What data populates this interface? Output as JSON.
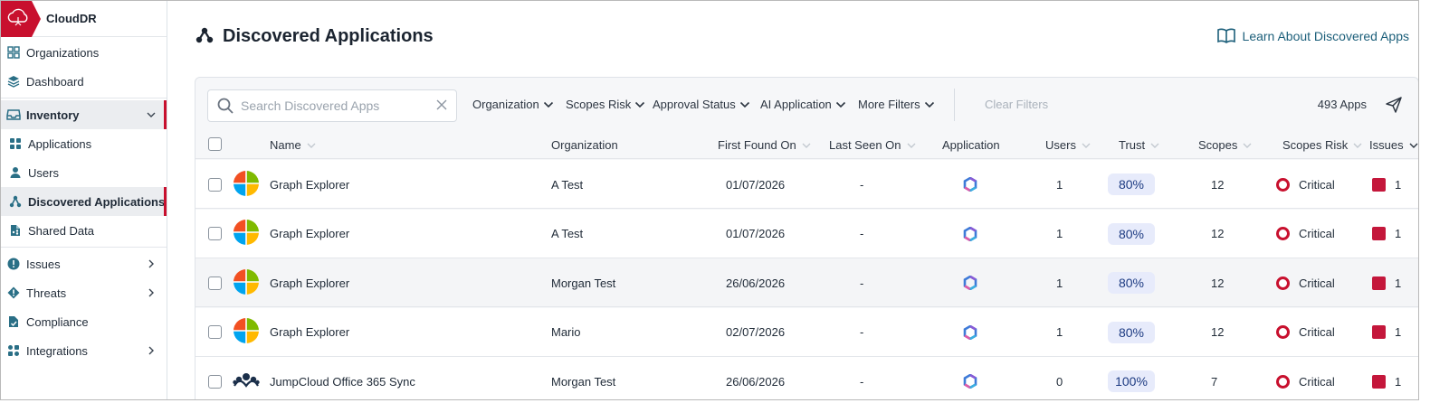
{
  "brand": {
    "name": "CloudDR",
    "accent": "#c8102e"
  },
  "sidebar": {
    "items": [
      {
        "label": "Organizations",
        "icon": "organizations-icon"
      },
      {
        "label": "Dashboard",
        "icon": "dashboard-icon"
      },
      {
        "label": "Inventory",
        "icon": "inventory-icon",
        "expanded": true
      },
      {
        "label": "Applications",
        "icon": "applications-icon"
      },
      {
        "label": "Users",
        "icon": "user-icon"
      },
      {
        "label": "Discovered Applications",
        "icon": "discovered-apps-icon",
        "selected": true
      },
      {
        "label": "Shared Data",
        "icon": "shared-data-icon"
      },
      {
        "label": "Issues",
        "icon": "issues-icon"
      },
      {
        "label": "Threats",
        "icon": "threats-icon"
      },
      {
        "label": "Compliance",
        "icon": "compliance-icon"
      },
      {
        "label": "Integrations",
        "icon": "integrations-icon"
      }
    ]
  },
  "header": {
    "title": "Discovered Applications",
    "learn_link": "Learn About Discovered Apps"
  },
  "toolbar": {
    "search_placeholder": "Search Discovered Apps",
    "filters": [
      "Organization",
      "Scopes Risk",
      "Approval Status",
      "AI Application",
      "More Filters"
    ],
    "clear_filters": "Clear Filters",
    "count": "493 Apps"
  },
  "table": {
    "columns": [
      "Name",
      "Organization",
      "First Found On",
      "Last Seen On",
      "Application",
      "Users",
      "Trust",
      "Scopes",
      "Scopes Risk",
      "Issues"
    ],
    "rows": [
      {
        "icon": "microsoft-logo-icon",
        "name": "Graph Explorer",
        "organization": "A Test",
        "first_found": "01/07/2026",
        "last_seen": "-",
        "application_icon": "m365-copilot-icon",
        "users": "1",
        "trust": "80%",
        "scopes": "12",
        "scopes_risk": "Critical",
        "issues": "1"
      },
      {
        "icon": "microsoft-logo-icon",
        "name": "Graph Explorer",
        "organization": "A Test",
        "first_found": "01/07/2026",
        "last_seen": "-",
        "application_icon": "m365-copilot-icon",
        "users": "1",
        "trust": "80%",
        "scopes": "12",
        "scopes_risk": "Critical",
        "issues": "1"
      },
      {
        "icon": "microsoft-logo-icon",
        "name": "Graph Explorer",
        "organization": "Morgan Test",
        "first_found": "26/06/2026",
        "last_seen": "-",
        "application_icon": "m365-copilot-icon",
        "users": "1",
        "trust": "80%",
        "scopes": "12",
        "scopes_risk": "Critical",
        "issues": "1"
      },
      {
        "icon": "microsoft-logo-icon",
        "name": "Graph Explorer",
        "organization": "Mario",
        "first_found": "02/07/2026",
        "last_seen": "-",
        "application_icon": "m365-copilot-icon",
        "users": "1",
        "trust": "80%",
        "scopes": "12",
        "scopes_risk": "Critical",
        "issues": "1"
      },
      {
        "icon": "jumpcloud-logo-icon",
        "name": "JumpCloud Office 365 Sync",
        "organization": "Morgan Test",
        "first_found": "26/06/2026",
        "last_seen": "-",
        "application_icon": "m365-copilot-icon",
        "users": "0",
        "trust": "100%",
        "scopes": "7",
        "scopes_risk": "Critical",
        "issues": "1"
      }
    ]
  }
}
